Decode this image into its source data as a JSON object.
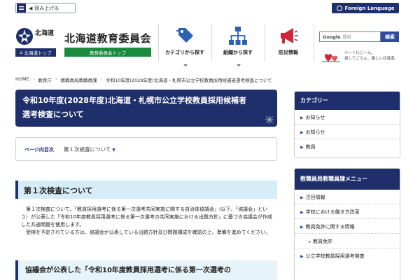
{
  "topbar": {
    "read_aloud": "読み上げる",
    "foreign_language": "Foreign Language"
  },
  "header": {
    "prefecture": "北海道",
    "prefecture_top": "北海道トップ",
    "board_name": "北海道教育委員会",
    "board_top": "教育委員会トップ",
    "nav": [
      {
        "label": "カテゴリから探す",
        "icon": "tag-icon"
      },
      {
        "label": "組織から探す",
        "icon": "org-chart-icon"
      },
      {
        "label": "防災情報",
        "icon": "megaphone-icon"
      }
    ],
    "search_brand": "Google",
    "search_placeholder": "提供",
    "search_button": "検索",
    "tagline_1": "ハートにじーん、",
    "tagline_2": "探してごらん、優しい北海道。"
  },
  "breadcrumb": [
    "HOME",
    "教育庁",
    "教職員局教職員課",
    "令和10年度(2028年度)北海道・札幌市公立学校教員採用候補者選考検査について"
  ],
  "main": {
    "title_line1": "令和10年度(2028年度)北海道・札幌市公立学校教員採用候補者",
    "title_line2": "選考検査について",
    "toc_label": "ページ内目次",
    "toc_link": "第１次検査について",
    "section_heading": "第１次検査について",
    "paragraph1": "第１次検査について、「教員採用選考に係る第一次選考共同実施に関する自治体協議会」(以下、「協議会」という）が公表した「令和10年度教員採用選考に係る第一次選考の共同実施における出題方針」に基づき協議会が作成した共通問題を使用します。",
    "paragraph2": "受検を予定されている方は、協議会が公表している出題方針及び問題構成を確認の上、準備を進めてください。",
    "subheading": "協議会が公表した「令和10年度教員採用選考に係る第一次選考の"
  },
  "sidebar": {
    "category_title": "カテゴリー",
    "categories": [
      "お知らせ",
      "お知らせ",
      "教員"
    ],
    "menu_title": "教職員局教職員課メニュー",
    "menu": [
      {
        "label": "注目情報",
        "sub": false
      },
      {
        "label": "学校における働き方改革",
        "sub": false
      },
      {
        "label": "教員免許に関する情報",
        "sub": false
      },
      {
        "label": "教員免許",
        "sub": true
      },
      {
        "label": "公立学校教員採用選考検査",
        "sub": false
      },
      {
        "label": "",
        "sub": false
      },
      {
        "label": "",
        "sub": false
      }
    ]
  },
  "colors": {
    "navy": "#1f2f6b",
    "green": "#1a8a3e",
    "light_blue": "#d6edf7",
    "red": "#d0263a"
  }
}
